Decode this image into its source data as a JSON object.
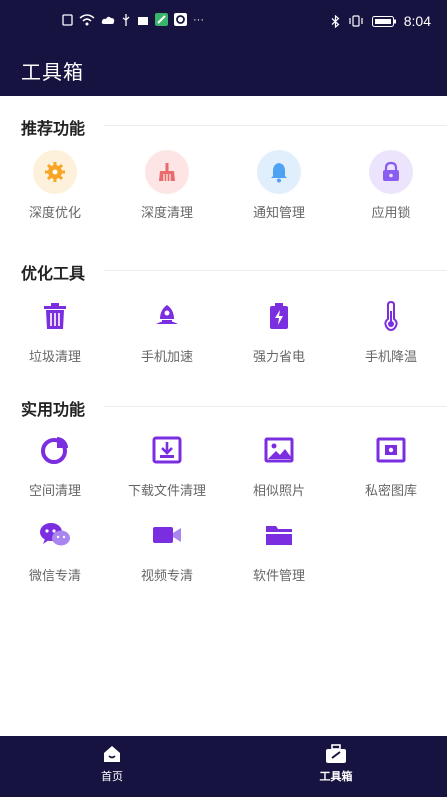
{
  "status_bar": {
    "time": "8:04",
    "left_icons": [
      "sim-icon",
      "wifi-icon",
      "cloud-icon",
      "usb-icon",
      "notification-icon",
      "map-icon",
      "app-icon",
      "more-icon"
    ],
    "right_icons": [
      "bluetooth-icon",
      "vibrate-icon",
      "battery-icon"
    ]
  },
  "header": {
    "title": "工具箱"
  },
  "sections": [
    {
      "title": "推荐功能",
      "items": [
        {
          "label": "深度优化",
          "icon": "gear-icon"
        },
        {
          "label": "深度清理",
          "icon": "broom-icon"
        },
        {
          "label": "通知管理",
          "icon": "bell-icon"
        },
        {
          "label": "应用锁",
          "icon": "lock-icon"
        }
      ]
    },
    {
      "title": "优化工具",
      "items": [
        {
          "label": "垃圾清理",
          "icon": "trash-icon"
        },
        {
          "label": "手机加速",
          "icon": "rocket-icon"
        },
        {
          "label": "强力省电",
          "icon": "battery-bolt-icon"
        },
        {
          "label": "手机降温",
          "icon": "thermometer-icon"
        }
      ]
    },
    {
      "title": "实用功能",
      "items": [
        {
          "label": "空间清理",
          "icon": "pie-chart-icon"
        },
        {
          "label": "下载文件清理",
          "icon": "download-icon"
        },
        {
          "label": "相似照片",
          "icon": "image-icon"
        },
        {
          "label": "私密图库",
          "icon": "private-gallery-icon"
        },
        {
          "label": "微信专清",
          "icon": "wechat-icon"
        },
        {
          "label": "视频专清",
          "icon": "video-icon"
        },
        {
          "label": "软件管理",
          "icon": "folder-icon"
        }
      ]
    }
  ],
  "tab_bar": {
    "tabs": [
      {
        "label": "首页",
        "icon": "home-icon"
      },
      {
        "label": "工具箱",
        "icon": "toolbox-icon",
        "active": true
      }
    ]
  },
  "colors": {
    "dark": "#171341",
    "purple": "#7a2ee0",
    "orange": "#f6a623",
    "red": "#e86c6c",
    "blue": "#4ea1f3",
    "lilac": "#8a5cf0"
  }
}
